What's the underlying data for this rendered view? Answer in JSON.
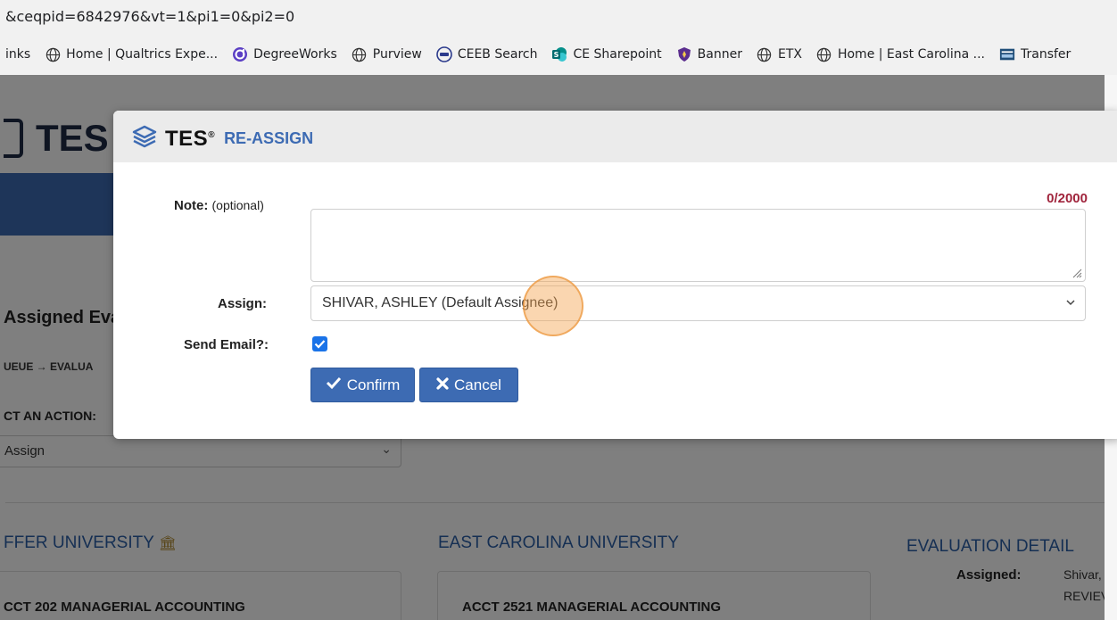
{
  "browser": {
    "url": "&ceqpid=6842976&vt=1&pi1=0&pi2=0",
    "bookmarks": [
      {
        "label": "inks",
        "icon": "none"
      },
      {
        "label": "Home | Qualtrics Expe...",
        "icon": "globe-icon"
      },
      {
        "label": "DegreeWorks",
        "icon": "degreeworks-icon"
      },
      {
        "label": "Purview",
        "icon": "globe-icon"
      },
      {
        "label": "CEEB Search",
        "icon": "ceeb-icon"
      },
      {
        "label": "CE Sharepoint",
        "icon": "sharepoint-icon"
      },
      {
        "label": "Banner",
        "icon": "banner-icon"
      },
      {
        "label": "ETX",
        "icon": "globe-icon"
      },
      {
        "label": "Home | East Carolina ...",
        "icon": "globe-icon"
      },
      {
        "label": "Transfer",
        "icon": "transfer-icon"
      }
    ]
  },
  "background": {
    "app_title": "TES",
    "assigned_heading": "Assigned Eva",
    "queue_breadcrumb": "UEUE → EVALUA",
    "action_label": "CT AN ACTION:",
    "action_value": "Assign",
    "left_university": "FFER UNIVERSITY",
    "middle_university": "EAST CAROLINA UNIVERSITY",
    "right_heading": "EVALUATION DETAIL",
    "left_course": "CCT 202 MANAGERIAL ACCOUNTING",
    "middle_course": "ACCT 2521 MANAGERIAL ACCOUNTING",
    "assigned_label": "Assigned:",
    "assigned_value_1": "Shivar,",
    "assigned_value_2": "REVIEV"
  },
  "modal": {
    "brand": "TES",
    "title": "RE-ASSIGN",
    "note_label": "Note:",
    "note_optional": "(optional)",
    "note_counter": "0/2000",
    "note_value": "",
    "assign_label": "Assign:",
    "assign_value": "SHIVAR, ASHLEY (Default Assignee)",
    "send_email_label": "Send Email?:",
    "send_email_checked": true,
    "confirm_label": "Confirm",
    "cancel_label": "Cancel"
  },
  "colors": {
    "accent": "#3d6bb3",
    "counter": "#a0243c",
    "checkbox": "#1a73e8"
  }
}
